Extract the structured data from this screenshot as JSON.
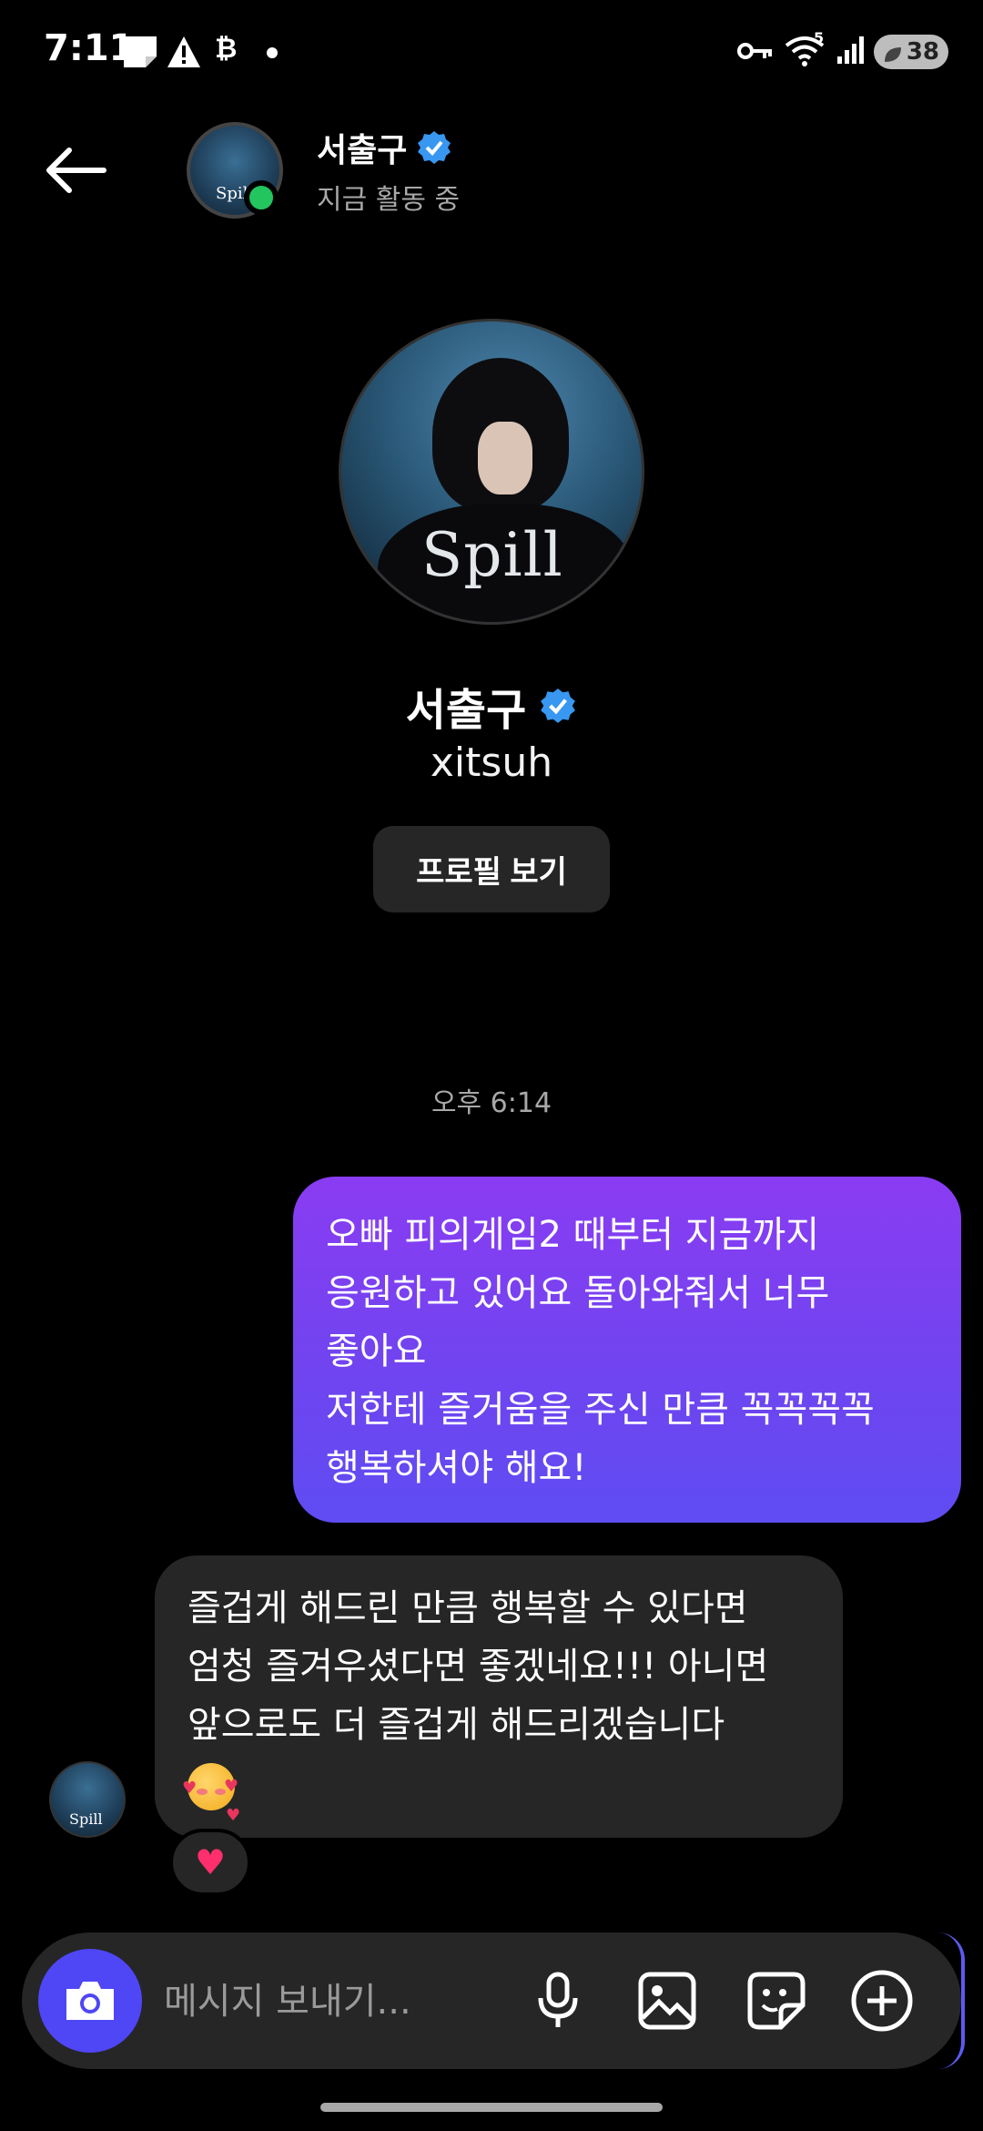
{
  "status_bar": {
    "time": "7:11",
    "wifi_badge": "5",
    "battery": "38",
    "icons": [
      "note-icon",
      "alert-icon",
      "bitcoin-b-icon",
      "dot-icon",
      "key-icon",
      "wifi-icon",
      "signal-icon",
      "battery-icon"
    ]
  },
  "header": {
    "name": "서출구",
    "status": "지금 활동 중",
    "avatar_text": "Spil"
  },
  "profile": {
    "logo": "Spill",
    "name": "서출구",
    "handle": "xitsuh",
    "view_profile_label": "프로필 보기"
  },
  "messages": {
    "timestamp": "오후 6:14",
    "outgoing": {
      "lines": [
        "오빠 피의게임2 때부터 지금까지",
        "응원하고 있어요 돌아와줘서 너무",
        "좋아요",
        "저한테 즐거움을 주신 만큼 꼭꼭꼭꼭",
        "행복하셔야 해요!"
      ]
    },
    "incoming": {
      "lines": [
        "즐겁게 해드린 만큼 행복할 수 있다면",
        "엄청 즐겨우셨다면 좋겠네요!!! 아니면",
        "앞으로도 더 즐겁게 해드리겠습니다"
      ],
      "emoji": "smiling-face-with-hearts",
      "reaction": "heart",
      "avatar_text": "Spill"
    }
  },
  "composer": {
    "placeholder": "메시지 보내기..."
  },
  "colors": {
    "background": "#000000",
    "outgoing_bubble": "#7a41f2",
    "incoming_bubble": "#262626",
    "accent": "#4f46f5",
    "verified": "#3897f0",
    "online": "#22c55e"
  }
}
